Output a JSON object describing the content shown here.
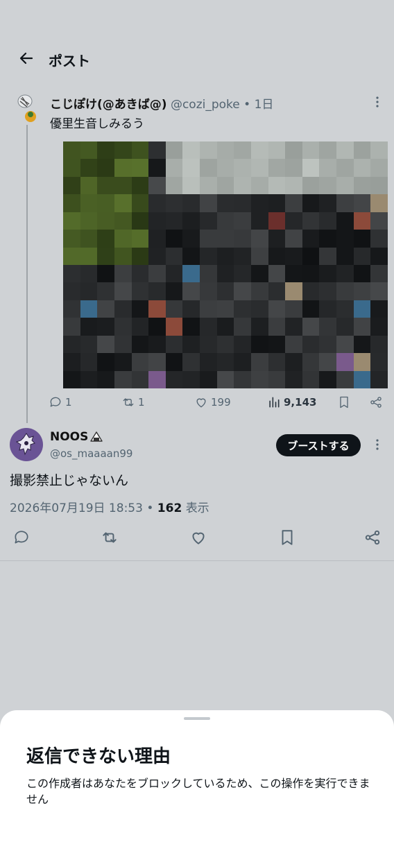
{
  "header": {
    "title": "ポスト"
  },
  "parent_post": {
    "display_name": "こじぽけ(@あきば@)",
    "handle": "@cozi_poke",
    "time": " • 1日",
    "text": "優里生音しみるう",
    "replies": "1",
    "reposts": "1",
    "likes": "199",
    "views": "9,143"
  },
  "main_post": {
    "display_name": "NOOS",
    "handle": "@os_maaaan99",
    "boost_label": "ブーストする",
    "text": "撮影禁止じゃないん",
    "date": "2026年07月19日 18:53",
    "views_count": "162",
    "views_label": "表示"
  },
  "sheet": {
    "title": "返信できない理由",
    "body": "この作成者はあなたをブロックしているため、この操作を実行できません"
  },
  "colors": {
    "overlay": "#cfd2d5",
    "boost_button": "#0f1419",
    "avatar": "#6a5395"
  }
}
